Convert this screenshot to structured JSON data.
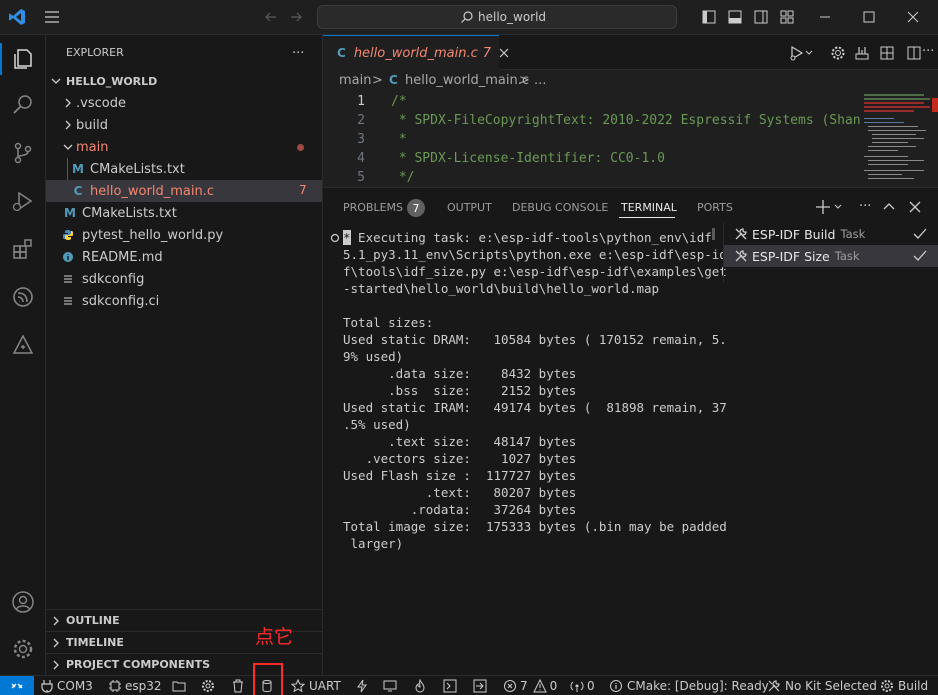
{
  "titlebar": {
    "search_text": "hello_world"
  },
  "explorer": {
    "title": "EXPLORER",
    "folder": "HELLO_WORLD",
    "items": [
      {
        "label": ".vscode",
        "kind": "folder-collapsed"
      },
      {
        "label": "build",
        "kind": "folder-collapsed"
      },
      {
        "label": "main",
        "kind": "folder-expanded"
      },
      {
        "label": "CMakeLists.txt",
        "kind": "cmake",
        "icon_letter": "M"
      },
      {
        "label": "hello_world_main.c",
        "kind": "c",
        "icon_letter": "C",
        "badge": "7"
      },
      {
        "label": "CMakeLists.txt",
        "kind": "cmake",
        "icon_letter": "M"
      },
      {
        "label": "pytest_hello_world.py",
        "kind": "python"
      },
      {
        "label": "README.md",
        "kind": "info"
      },
      {
        "label": "sdkconfig",
        "kind": "config"
      },
      {
        "label": "sdkconfig.ci",
        "kind": "config"
      }
    ],
    "sections": [
      "OUTLINE",
      "TIMELINE",
      "PROJECT COMPONENTS"
    ]
  },
  "editor": {
    "tab_icon_letter": "C",
    "tab_label": "hello_world_main.c",
    "tab_badge": "7",
    "breadcrumb_root": "main",
    "breadcrumb_sep": ">",
    "breadcrumb_file": "hello_world_main.c",
    "breadcrumb_tail": "> ...",
    "lines": [
      {
        "num": "1",
        "text": "/*"
      },
      {
        "num": "2",
        "text": " * SPDX-FileCopyrightText: 2010-2022 Espressif Systems (Shang"
      },
      {
        "num": "3",
        "text": " *"
      },
      {
        "num": "4",
        "text": " * SPDX-License-Identifier: CC0-1.0"
      },
      {
        "num": "5",
        "text": " */"
      }
    ]
  },
  "panel": {
    "tabs": [
      "PROBLEMS",
      "OUTPUT",
      "DEBUG CONSOLE",
      "TERMINAL",
      "PORTS"
    ],
    "problems_count": "7",
    "active_tab": "TERMINAL",
    "terminal_badge": "*",
    "terminal_first": " Executing task: e:\\esp-idf-tools\\python_env\\idf",
    "terminal_lines": [
      "5.1_py3.11_env\\Scripts\\python.exe e:\\esp-idf\\esp-id",
      "f\\tools\\idf_size.py e:\\esp-idf\\esp-idf\\examples\\get",
      "-started\\hello_world\\build\\hello_world.map",
      "",
      "Total sizes:",
      "Used static DRAM:   10584 bytes ( 170152 remain, 5.",
      "9% used)",
      "      .data size:    8432 bytes",
      "      .bss  size:    2152 bytes",
      "Used static IRAM:   49174 bytes (  81898 remain, 37",
      ".5% used)",
      "      .text size:   48147 bytes",
      "   .vectors size:    1027 bytes",
      "Used Flash size :  117727 bytes",
      "           .text:   80207 bytes",
      "         .rodata:   37264 bytes",
      "Total image size:  175333 bytes (.bin may be padded",
      " larger)"
    ],
    "tasks": [
      {
        "name": "ESP-IDF Build",
        "suffix": "Task"
      },
      {
        "name": "ESP-IDF Size",
        "suffix": "Task"
      }
    ]
  },
  "annotation": {
    "text": "点它",
    "color": "#ff2a2a"
  },
  "statusbar": {
    "port": "COM3",
    "target": "esp32",
    "flash_method": "UART",
    "errors": "7",
    "warnings": "0",
    "ports_count": "0",
    "cmake": "CMake: [Debug]: Ready",
    "kit": "No Kit Selected",
    "build": "Build"
  },
  "colors": {
    "accent": "#0078d4",
    "error_file": "#f48771",
    "c_icon": "#519aba",
    "comment": "#6a9955"
  }
}
